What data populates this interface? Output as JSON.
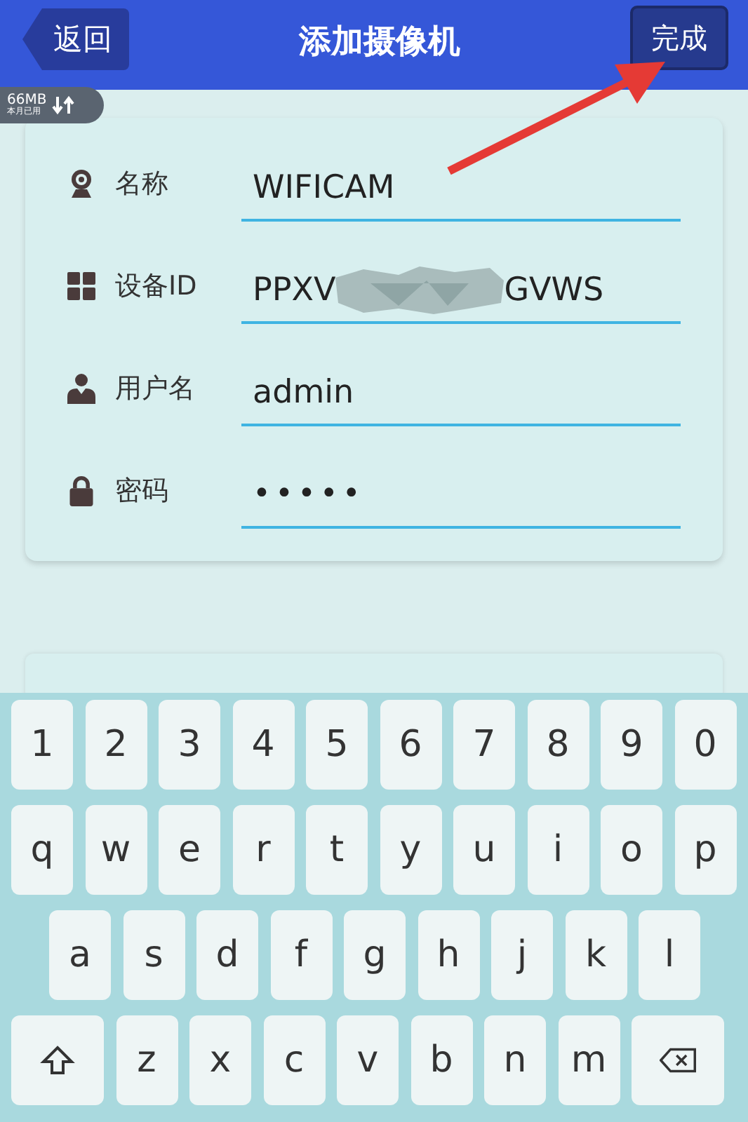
{
  "header": {
    "back_button": "返回",
    "title": "添加摄像机",
    "done_button": "完成"
  },
  "data_badge": {
    "amount": "66MB",
    "caption": "本月已用"
  },
  "form": {
    "fields": [
      {
        "kind": "text",
        "label": "名称",
        "value": "WIFICAM"
      },
      {
        "kind": "redacted",
        "label": "设备ID",
        "value_start": "PPXV",
        "value_end": "GVWS"
      },
      {
        "kind": "text",
        "label": "用户名",
        "value": "admin"
      },
      {
        "kind": "password",
        "label": "密码",
        "value": "•••••"
      }
    ]
  },
  "keyboard": {
    "rows": [
      [
        "1",
        "2",
        "3",
        "4",
        "5",
        "6",
        "7",
        "8",
        "9",
        "0"
      ],
      [
        "q",
        "w",
        "e",
        "r",
        "t",
        "y",
        "u",
        "i",
        "o",
        "p"
      ],
      [
        "a",
        "s",
        "d",
        "f",
        "g",
        "h",
        "j",
        "k",
        "l"
      ],
      [
        "z",
        "x",
        "c",
        "v",
        "b",
        "n",
        "m"
      ]
    ]
  }
}
